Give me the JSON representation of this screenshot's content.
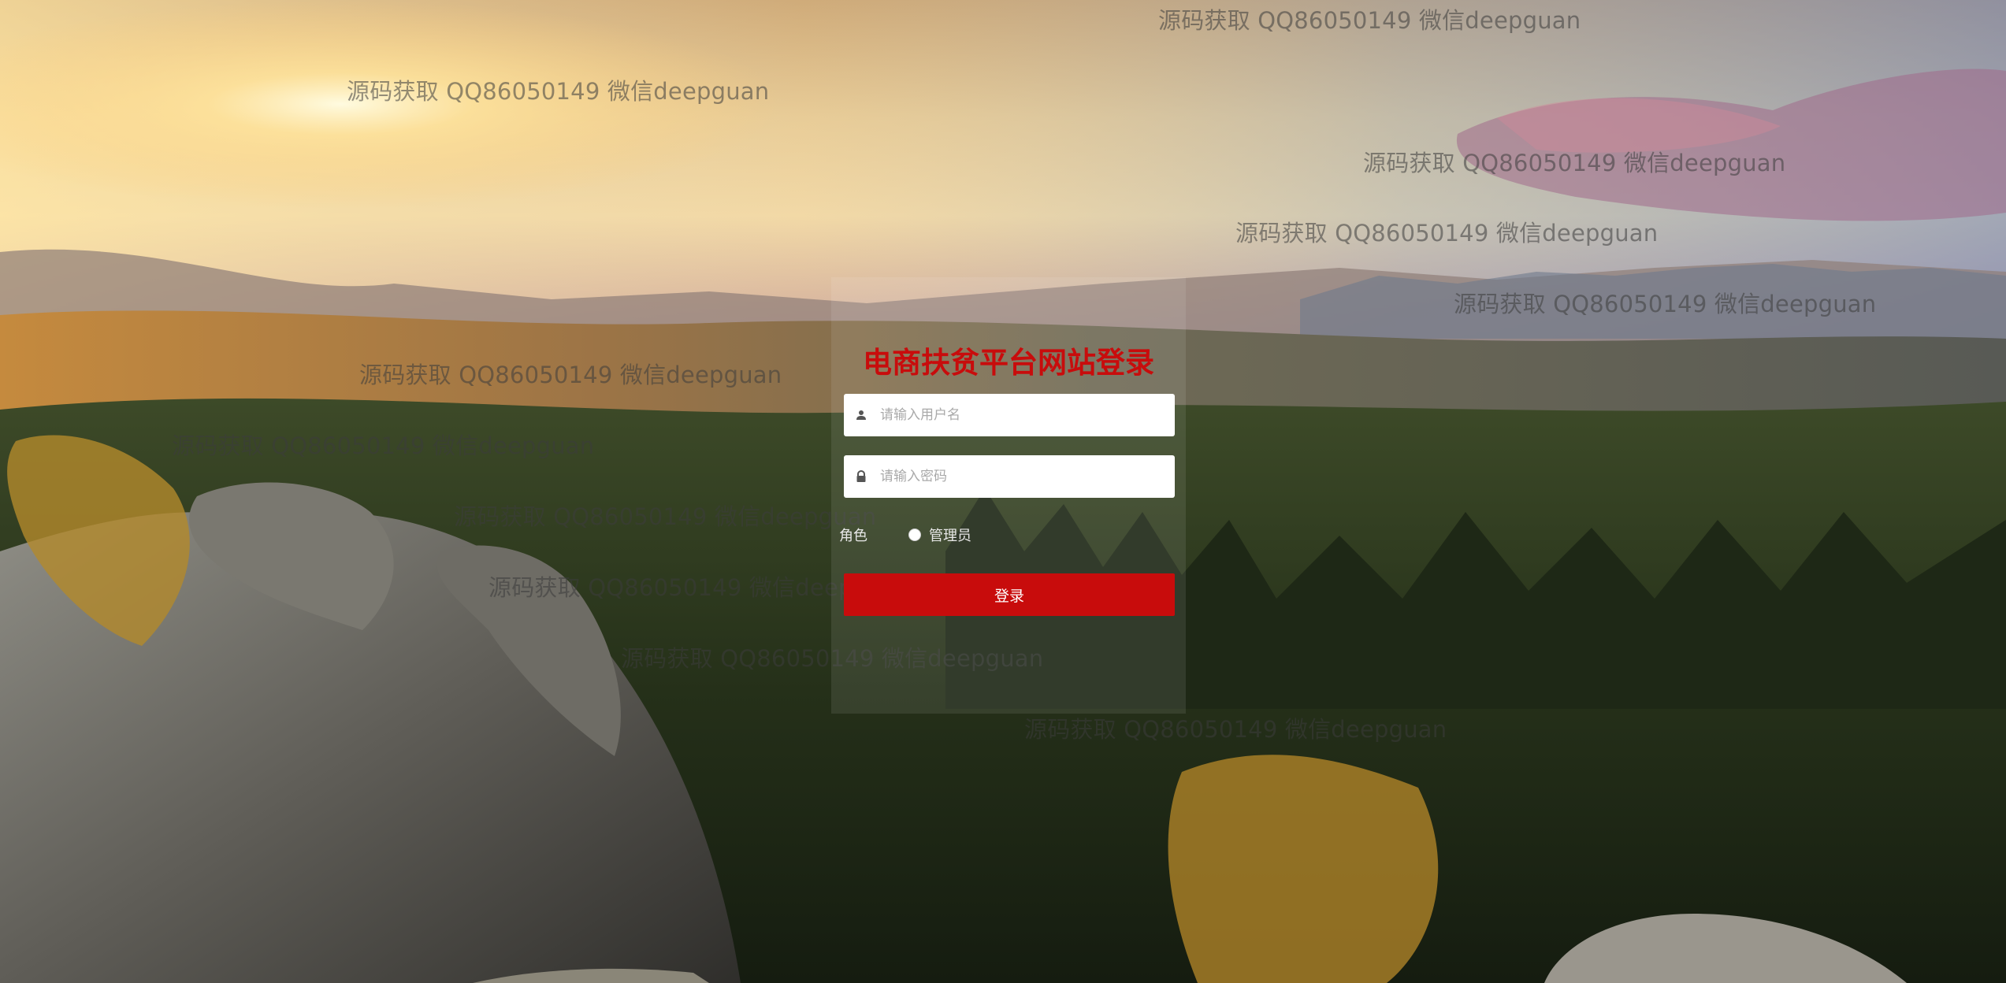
{
  "form": {
    "title": "电商扶贫平台网站登录",
    "username_placeholder": "请输入用户名",
    "password_placeholder": "请输入密码",
    "role_label": "角色",
    "role_options": [
      "管理员"
    ],
    "login_label": "登录"
  },
  "watermarks": [
    "源码获取 QQ86050149 微信deepguan",
    "源码获取 QQ86050149 微信deepguan",
    "源码获取 QQ86050149 微信deepguan",
    "源码获取 QQ86050149 微信deepguan",
    "源码获取 QQ86050149 微信deepguan",
    "源码获取 QQ86050149 微信deepguan",
    "源码获取 QQ86050149 微信deepguan",
    "源码获取 QQ86050149 微信deepguan",
    "源码获取 QQ86050149 微信deepguan",
    "源码获取 QQ86050149 微信deepguan",
    "源码获取 QQ86050149 微信deepguan"
  ],
  "colors": {
    "accent": "#c80c0c"
  }
}
